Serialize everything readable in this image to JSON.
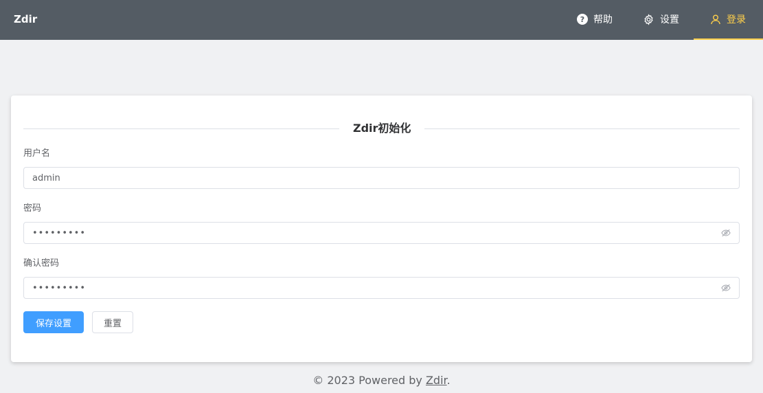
{
  "navbar": {
    "brand": "Zdir",
    "items": [
      {
        "label": "帮助",
        "icon": "question-circle-icon"
      },
      {
        "label": "设置",
        "icon": "gear-icon"
      },
      {
        "label": "登录",
        "icon": "user-icon",
        "active": true
      }
    ],
    "background": "#545c64",
    "active_color": "#ffd04b"
  },
  "form": {
    "title": "Zdir初始化",
    "username": {
      "label": "用户名",
      "value": "admin"
    },
    "password": {
      "label": "密码",
      "masked_value": "•••••••••"
    },
    "confirm_password": {
      "label": "确认密码",
      "masked_value": "•••••••••"
    },
    "submit_label": "保存设置",
    "reset_label": "重置",
    "primary_color": "#409eff"
  },
  "footer": {
    "prefix": "© 2023 Powered by ",
    "link_text": "Zdir",
    "suffix": "."
  }
}
